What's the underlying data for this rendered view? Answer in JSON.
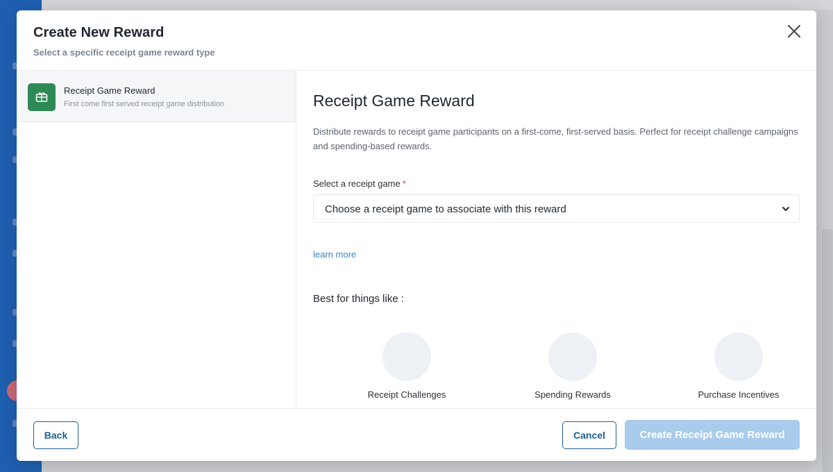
{
  "colors": {
    "accent": "#1d5e93",
    "link": "#3b82c4",
    "icon_bg": "#2e8a55",
    "primary_disabled": "#a9cbec",
    "required": "#e0394a"
  },
  "modal": {
    "title": "Create New Reward",
    "subtitle": "Select a specific receipt game reward type",
    "close_icon": "close-icon"
  },
  "reward_types": [
    {
      "title": "Receipt Game Reward",
      "description": "First come first served receipt game distribution",
      "icon": "gift-card-icon",
      "selected": true
    }
  ],
  "detail": {
    "title": "Receipt Game Reward",
    "description": "Distribute rewards to receipt game participants on a first-come, first-served basis. Perfect for receipt challenge campaigns and spending-based rewards.",
    "select_label": "Select a receipt game",
    "required_marker": "*",
    "select_placeholder": "Choose a receipt game to associate with this reward",
    "learn_more": "learn more",
    "best_for_label": "Best for things like :",
    "use_cases": [
      "Receipt Challenges",
      "Spending Rewards",
      "Purchase Incentives"
    ]
  },
  "footer": {
    "back_label": "Back",
    "cancel_label": "Cancel",
    "create_label": "Create Receipt Game Reward",
    "create_disabled": true
  }
}
